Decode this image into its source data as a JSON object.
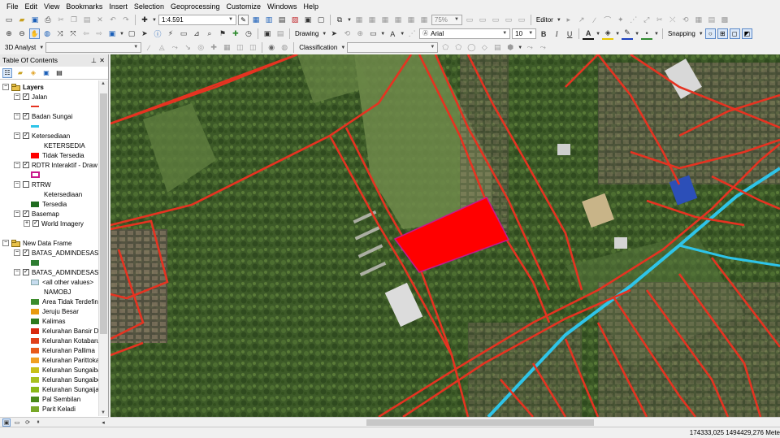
{
  "menu": [
    "File",
    "Edit",
    "View",
    "Bookmarks",
    "Insert",
    "Selection",
    "Geoprocessing",
    "Customize",
    "Windows",
    "Help"
  ],
  "toolbar1": {
    "scale": "1:4.591",
    "zoom_percent": "75%",
    "editor_label": "Editor"
  },
  "toolbar2": {
    "drawing_label": "Drawing",
    "font_name": "Arial",
    "font_size": "10",
    "bold": "B",
    "italic": "I",
    "underline": "U",
    "text_tool": "A",
    "snapping_label": "Snapping"
  },
  "toolbar3": {
    "analyst_label": "3D Analyst",
    "classification_label": "Classification"
  },
  "toc": {
    "title": "Table Of Contents",
    "items": [
      {
        "label": "Layers",
        "bold": true
      },
      {
        "label": "Jalan"
      },
      {
        "label": "Badan Sungai"
      },
      {
        "label": "Ketersediaan"
      },
      {
        "label": "KETERSEDIA"
      },
      {
        "label": "Tidak Tersedia"
      },
      {
        "label": "RDTR Interaktif - Draw"
      },
      {
        "label": "RTRW"
      },
      {
        "label": "Ketersediaan"
      },
      {
        "label": "Tersedia"
      },
      {
        "label": "Basemap"
      },
      {
        "label": "World Imagery"
      },
      {
        "label": "New Data Frame"
      },
      {
        "label": "BATAS_ADMINDESASI"
      },
      {
        "label": "BATAS_ADMINDESASI"
      },
      {
        "label": "<all other values>"
      },
      {
        "label": "NAMOBJ"
      },
      {
        "label": "Area Tidak Terdefini"
      },
      {
        "label": "Jeruju Besar"
      },
      {
        "label": "Kalimas"
      },
      {
        "label": "Kelurahan Bansir Da"
      },
      {
        "label": "Kelurahan Kotabaru"
      },
      {
        "label": "Kelurahan Pallima"
      },
      {
        "label": "Kelurahan Parittoka"
      },
      {
        "label": "Kelurahan Sungaiba"
      },
      {
        "label": "Kelurahan Sungaibe"
      },
      {
        "label": "Kelurahan Sungaija"
      },
      {
        "label": "Pal Sembilan"
      },
      {
        "label": "Parit Keladi"
      }
    ]
  },
  "colors": {
    "road": "#e53321",
    "river": "#2ec4e8",
    "highlight_parcel": "#ff0000",
    "parcel_outline": "#c8188c",
    "tersedia": "#1f6b1f"
  },
  "status": {
    "coordinates": "174333,025  1494429,276 Mete"
  }
}
